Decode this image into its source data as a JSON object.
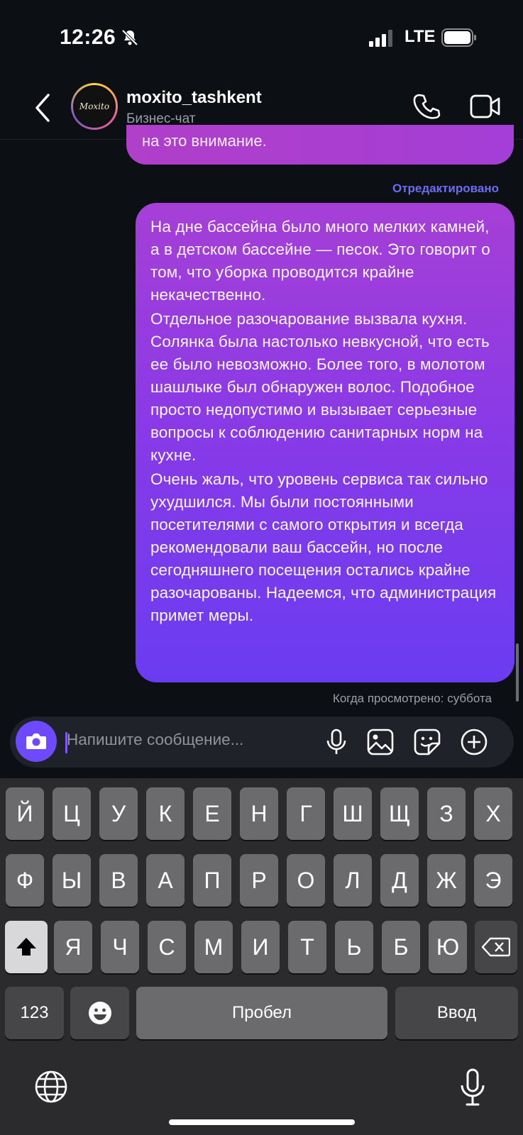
{
  "status": {
    "time": "12:26",
    "network": "LTE"
  },
  "header": {
    "name": "moxito_tashkent",
    "subtitle": "Бизнес-чат",
    "avatar_text": "Moxito"
  },
  "messages": {
    "previous_tail": "на это внимание.",
    "edited_label": "Отредактировано",
    "paragraphs": [
      "На дне бассейна было много мелких камней, а в детском бассейне — песок. Это говорит о том, что уборка проводится крайне некачественно.",
      "Отдельное разочарование вызвала кухня. Солянка была настолько невкусной, что есть ее было невозможно. Более того, в молотом шашлыке был обнаружен волос. Подобное просто недопустимо и вызывает серьезные вопросы к соблюдению санитарных норм на кухне.",
      "Очень жаль, что уровень сервиса так сильно ухудшился. Мы были постоянными посетителями с самого открытия и всегда рекомендовали ваш бассейн, но после сегодняшнего посещения остались крайне разочарованы. Надеемся, что администрация примет меры."
    ],
    "seen_label": "Когда просмотрено: суббота"
  },
  "composer": {
    "placeholder": "Напишите сообщение..."
  },
  "keyboard": {
    "row1": [
      "Й",
      "Ц",
      "У",
      "К",
      "Е",
      "Н",
      "Г",
      "Ш",
      "Щ",
      "З",
      "Х"
    ],
    "row2": [
      "Ф",
      "Ы",
      "В",
      "А",
      "П",
      "Р",
      "О",
      "Л",
      "Д",
      "Ж",
      "Э"
    ],
    "row3": [
      "Я",
      "Ч",
      "С",
      "М",
      "И",
      "Т",
      "Ь",
      "Б",
      "Ю"
    ],
    "numbers": "123",
    "space": "Пробел",
    "return": "Ввод"
  },
  "colors": {
    "accent": "#6d4aff",
    "edited": "#6c6cf7",
    "bubble_top": "#a63fd6",
    "bubble_bottom": "#6a3cf1"
  }
}
